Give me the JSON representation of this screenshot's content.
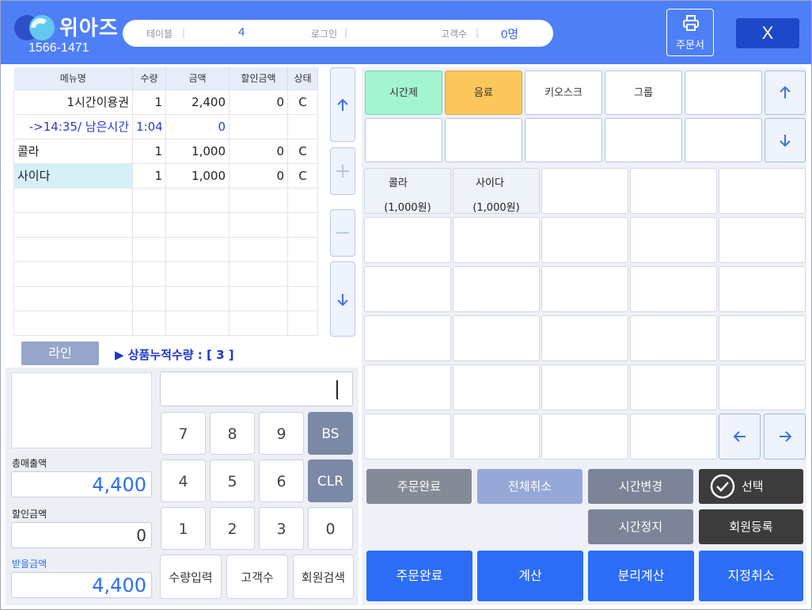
{
  "header": {
    "logo_text": "위아즈",
    "phone": "1566-1471",
    "table_label": "테이블",
    "table_value": "4",
    "login_label": "로그인",
    "login_value": "",
    "customers_label": "고객수",
    "customers_value": "0명",
    "print_label": "주문서",
    "close_label": "X",
    "brand_color": "#4f7ff7"
  },
  "order_table": {
    "columns": [
      "메뉴명",
      "수량",
      "금액",
      "할인금액",
      "상태"
    ],
    "rows": [
      {
        "name": "1시간이용권",
        "qty": "1",
        "amount": "2,400",
        "discount": "0",
        "status": "C"
      },
      {
        "name": "->14:35/ 남은시간",
        "qty": "1:04",
        "amount": "0",
        "discount": "",
        "status": ""
      },
      {
        "name": "콜라",
        "qty": "1",
        "amount": "1,000",
        "discount": "0",
        "status": "C"
      },
      {
        "name": "사이다",
        "qty": "1",
        "amount": "1,000",
        "discount": "0",
        "status": "C"
      }
    ]
  },
  "side_controls": [
    "up-arrow",
    "plus",
    "minus",
    "down-arrow"
  ],
  "line_button": "라인",
  "cumulative_text": "▶ 상품누적수량 : [ 3 ]",
  "summary": {
    "total_sales_label": "총매출액",
    "total_sales_value": "4,400",
    "discount_label": "할인금액",
    "discount_value": "0",
    "receive_label": "받을금액",
    "receive_value": "4,400"
  },
  "keypad": {
    "keys": [
      "7",
      "8",
      "9",
      "BS",
      "4",
      "5",
      "6",
      "CLR",
      "1",
      "2",
      "3",
      "0"
    ],
    "functions": [
      "수량입력",
      "고객수",
      "회원검색"
    ]
  },
  "categories": [
    "시간제",
    "음료",
    "키오스크",
    "그룹"
  ],
  "products": [
    {
      "name": "콜라",
      "price": "(1,000원)"
    },
    {
      "name": "사이다",
      "price": "(1,000원)"
    }
  ],
  "actions": {
    "order_complete_gray": "주문완료",
    "cancel_all": "전체취소",
    "change_time": "시간변경",
    "select": "선택",
    "stop_time": "시간정지",
    "register_member": "회원등록"
  },
  "bottom_buttons": [
    "주문완료",
    "계산",
    "분리계산",
    "지정취소"
  ]
}
